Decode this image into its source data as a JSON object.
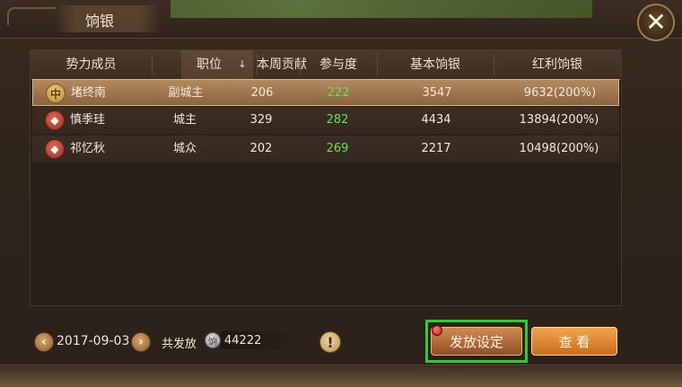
{
  "window": {
    "title": "饷银",
    "close_label": "✕"
  },
  "table": {
    "headers": [
      "势力成员",
      "职位",
      "本周贡献",
      "参与度",
      "基本饷银",
      "红利饷银"
    ],
    "sort_arrow": "↓",
    "rows": [
      {
        "name": "堵终南",
        "role": "副城主",
        "contribution": "206",
        "participation": "222",
        "base": "3547",
        "bonus": "9632(200%)",
        "badge": "gold",
        "selected": true
      },
      {
        "name": "慎季珪",
        "role": "城主",
        "contribution": "329",
        "participation": "282",
        "base": "4434",
        "bonus": "13894(200%)",
        "badge": "red",
        "selected": false
      },
      {
        "name": "祁忆秋",
        "role": "城众",
        "contribution": "202",
        "participation": "269",
        "base": "2217",
        "bonus": "10498(200%)",
        "badge": "red",
        "selected": false
      }
    ]
  },
  "footer": {
    "date": "2017-09-03",
    "prev_label": "‹",
    "next_label": "›",
    "total_label": "共发放",
    "total_icon": "饷",
    "total_value": "44222",
    "info_label": "!",
    "settings_button": "发放设定",
    "view_button": "查 看"
  },
  "colors": {
    "participation": "#62e05a",
    "highlight": "#2ecc2e"
  }
}
